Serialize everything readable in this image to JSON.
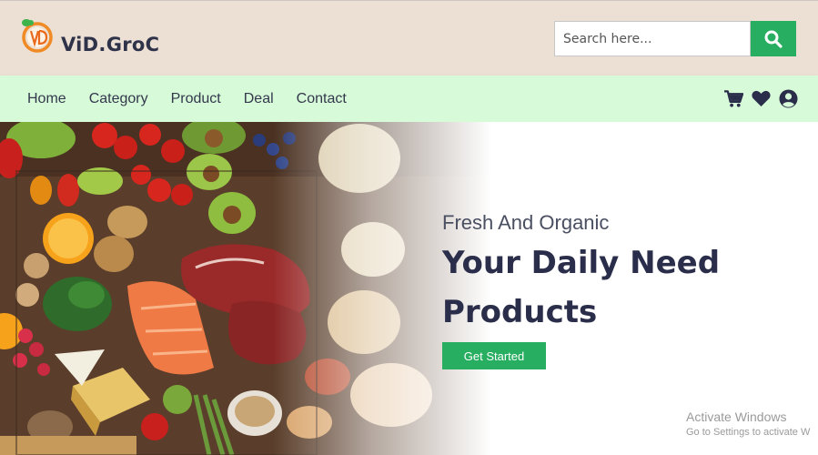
{
  "header": {
    "brand": "ViD.GroC",
    "logo_text": "VD",
    "search_placeholder": "Search here...",
    "search_button_icon": "search-icon"
  },
  "nav": {
    "links": [
      "Home",
      "Category",
      "Product",
      "Deal",
      "Contact"
    ],
    "icons": [
      "cart-icon",
      "heart-icon",
      "user-icon"
    ]
  },
  "hero": {
    "tagline": "Fresh And Organic",
    "headline": "Your Daily Need Products",
    "cta_label": "Get Started"
  },
  "watermark": {
    "title": "Activate Windows",
    "subtitle": "Go to Settings to activate W"
  },
  "colors": {
    "header_bg": "#ecdfd4",
    "nav_bg": "#d7fad8",
    "accent": "#27ae60",
    "text_dark": "#2a2e4a"
  }
}
